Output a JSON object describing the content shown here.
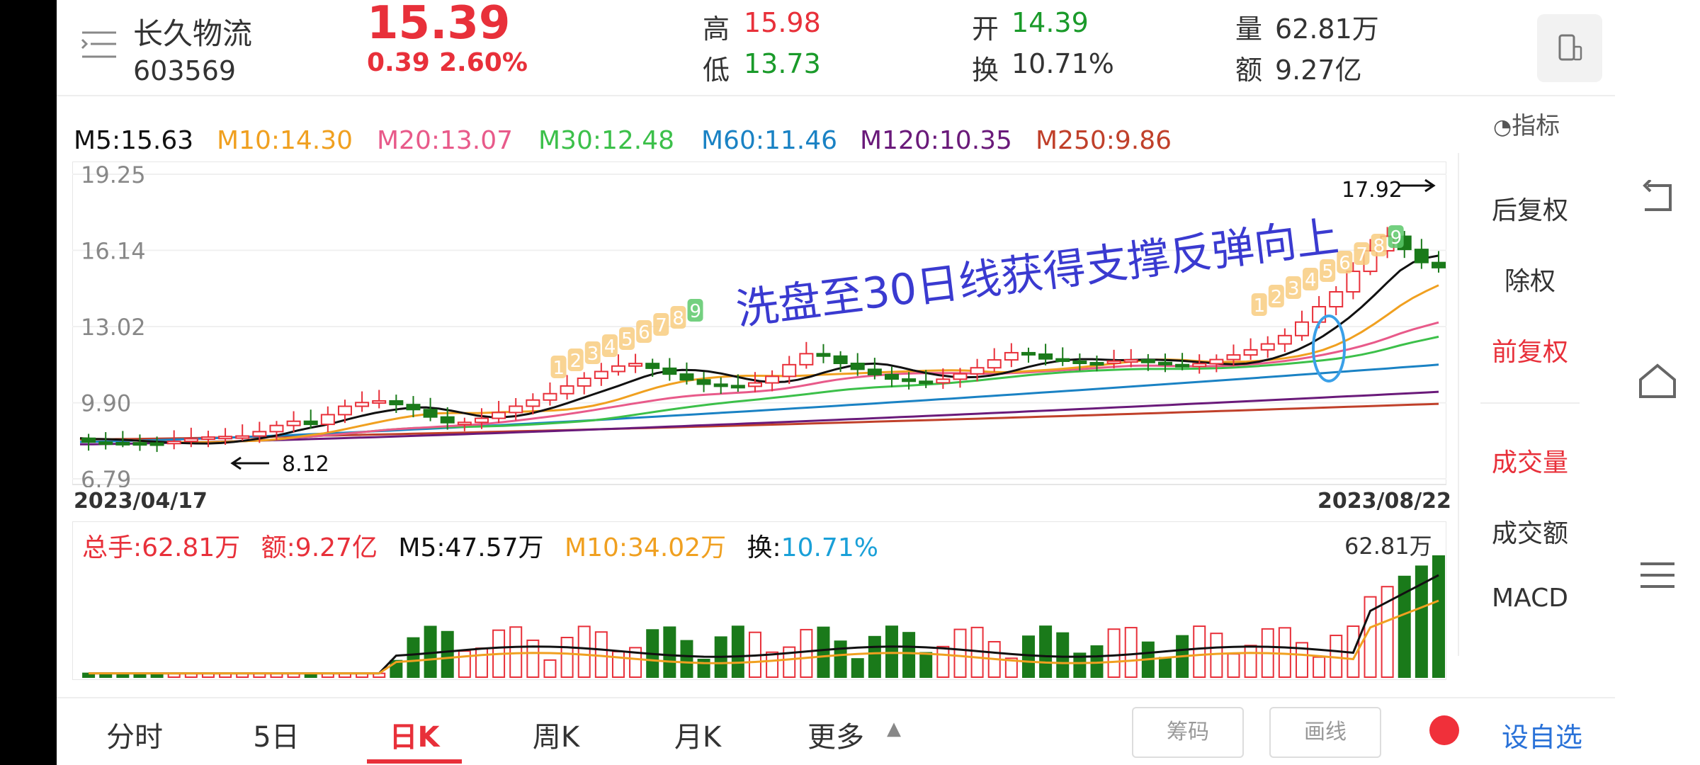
{
  "stock": {
    "name": "长久物流",
    "code": "603569",
    "price": "15.39",
    "change": "0.39",
    "change_pct": "2.60%",
    "high_label": "高",
    "high": "15.98",
    "low_label": "低",
    "low": "13.73",
    "open_label": "开",
    "open": "14.39",
    "turnover_label": "换",
    "turnover": "10.71%",
    "volume_label": "量",
    "volume": "62.81万",
    "amount_label": "额",
    "amount": "9.27亿"
  },
  "indicator_label": "指标",
  "ma": {
    "m5": "M5:15.63",
    "m10": "M10:14.30",
    "m20": "M20:13.07",
    "m30": "M30:12.48",
    "m60": "M60:11.46",
    "m120": "M120:10.35",
    "m250": "M250:9.86"
  },
  "axis": {
    "y_ticks": [
      "19.25",
      "16.14",
      "13.02",
      "9.90",
      "6.79"
    ],
    "date_start": "2023/04/17",
    "date_end": "2023/08/22"
  },
  "annotations": {
    "high_marker": "17.92",
    "low_marker": "8.12",
    "handwritten": "洗盘至30日线获得支撑反弹向上",
    "td_seq_left": [
      "1",
      "2",
      "3",
      "4",
      "5",
      "6",
      "7",
      "8",
      "9"
    ],
    "td_seq_right": [
      "1",
      "2",
      "3",
      "4",
      "5",
      "6",
      "7",
      "8",
      "9"
    ]
  },
  "volume_info": {
    "total": "总手:62.81万",
    "amount": "额:9.27亿",
    "m5": "M5:47.57万",
    "m10": "M10:34.02万",
    "turnover_label": "换:",
    "turnover": "10.71%",
    "max_label": "62.81万"
  },
  "side_menu": {
    "items": [
      "后复权",
      "除权",
      "前复权",
      "成交量",
      "成交额",
      "MACD"
    ],
    "active": [
      "前复权",
      "成交量"
    ]
  },
  "bottom_tabs": {
    "items": [
      "分时",
      "5日",
      "日K",
      "周K",
      "月K",
      "更多"
    ],
    "active": "日K",
    "chips": [
      "筹码",
      "画线"
    ],
    "add_watch": "设自选"
  },
  "colors": {
    "up": "#e8303a",
    "down": "#1a7a1a",
    "m5": "#111111",
    "m10": "#f0a020",
    "m20": "#e85a8a",
    "m30": "#3cc04a",
    "m60": "#1a82c4",
    "m120": "#6a1a7a",
    "m250": "#c0402a",
    "annotation": "#3a3ad0"
  },
  "chart_data": {
    "type": "candlestick",
    "price_range": [
      6.79,
      19.25
    ],
    "y_ticks": [
      19.25,
      16.14,
      13.02,
      9.9,
      6.79
    ],
    "date_range": [
      "2023/04/17",
      "2023/08/22"
    ],
    "high": 17.92,
    "low": 8.12,
    "close_last": 15.39,
    "moving_averages": {
      "M5": 15.63,
      "M10": 14.3,
      "M20": 13.07,
      "M30": 12.48,
      "M60": 11.46,
      "M120": 10.35,
      "M250": 9.86
    },
    "volume_last": "62.81万",
    "volume_ma": {
      "M5": "47.57万",
      "M10": "34.02万"
    },
    "volume_max": "62.81万"
  }
}
